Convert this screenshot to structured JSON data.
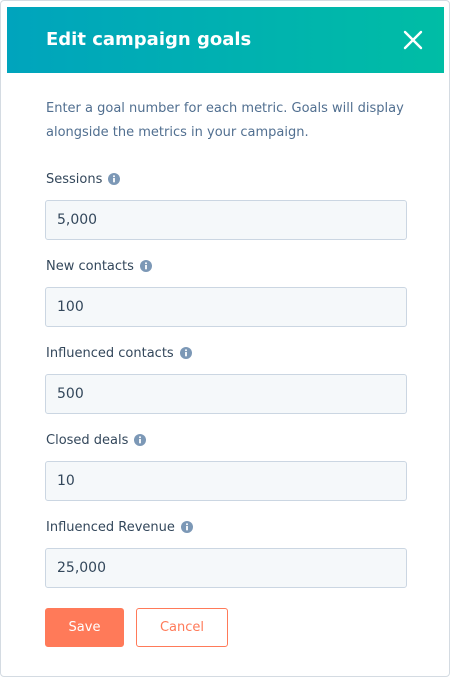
{
  "dialog": {
    "title": "Edit campaign goals",
    "close_icon": "close-icon",
    "description": "Enter a goal number for each metric. Goals will display alongside the metrics in your campaign."
  },
  "fields": [
    {
      "label": "Sessions",
      "value": "5,000",
      "icon": "info-icon"
    },
    {
      "label": "New contacts",
      "value": "100",
      "icon": "info-icon"
    },
    {
      "label": "Influenced contacts",
      "value": "500",
      "icon": "info-icon"
    },
    {
      "label": "Closed deals",
      "value": "10",
      "icon": "info-icon"
    },
    {
      "label": "Influenced Revenue",
      "value": "25,000",
      "icon": "info-icon"
    }
  ],
  "actions": {
    "save_label": "Save",
    "cancel_label": "Cancel"
  },
  "colors": {
    "header_gradient_start": "#00a4bd",
    "header_gradient_end": "#00bda5",
    "primary_button": "#ff7a59",
    "label_text": "#33475b",
    "description_text": "#516f90",
    "input_background": "#f5f8fa",
    "info_icon": "#7c98b6"
  }
}
